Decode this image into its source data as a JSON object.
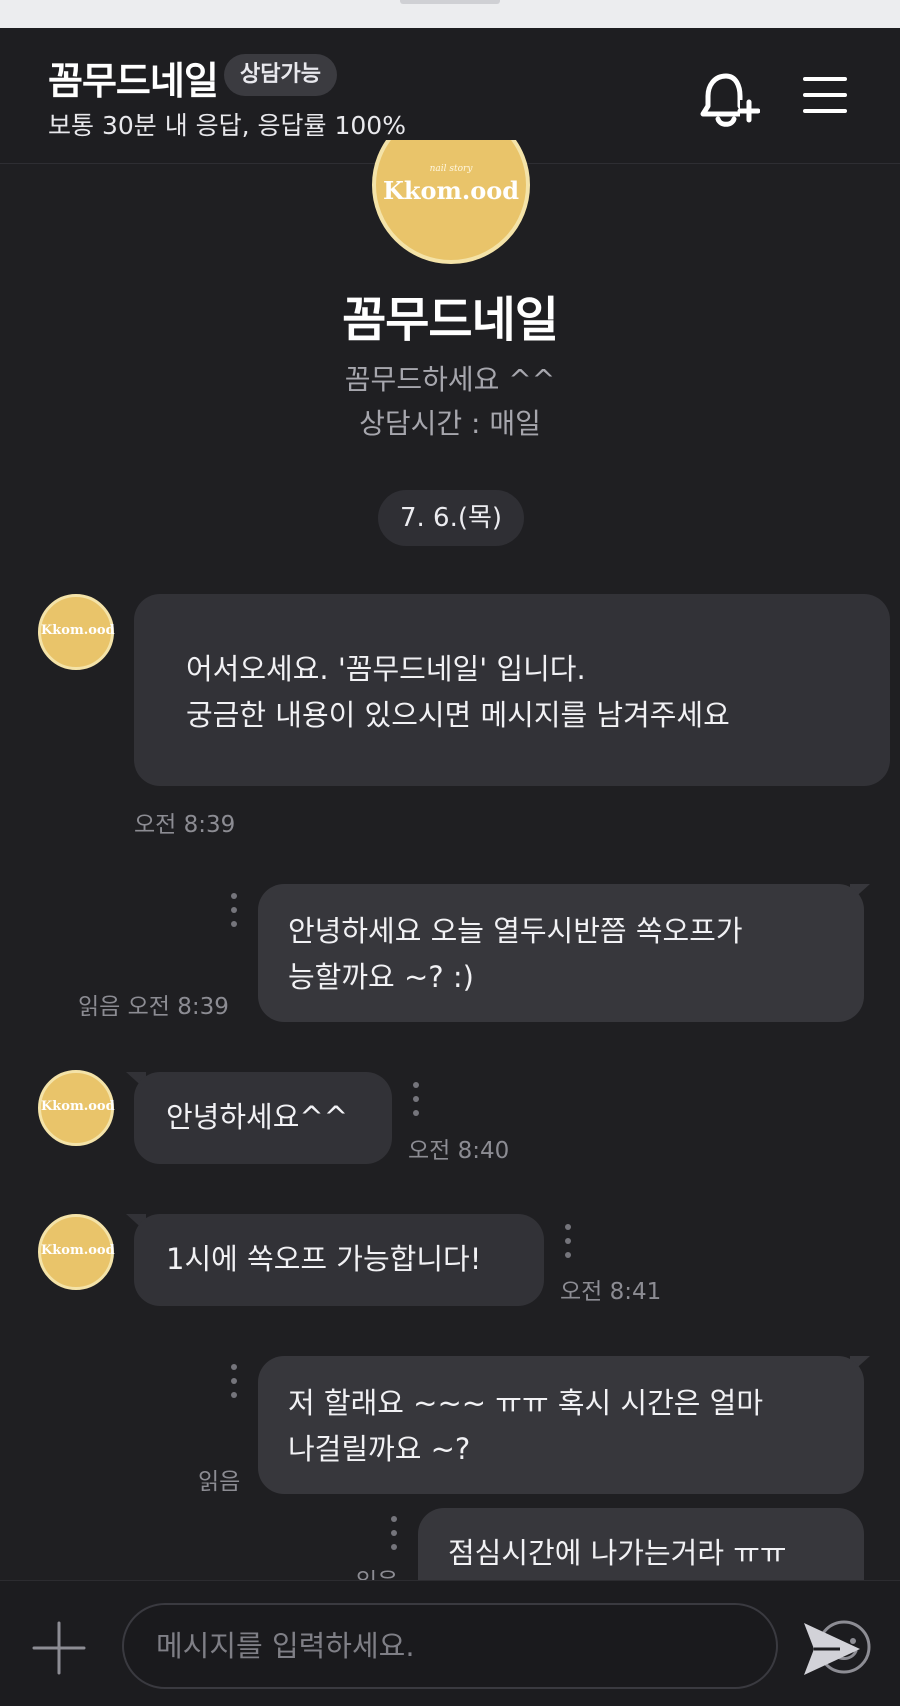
{
  "header": {
    "title": "꼼무드네일",
    "status_badge": "상담가능",
    "subtitle": "보통 30분 내 응답, 응답률 100%"
  },
  "profile": {
    "logo_text": "Kkom.ood",
    "logo_small": "nail story",
    "name": "꼼무드네일",
    "intro_line1": "꼼무드하세요 ^^",
    "intro_line2": "상담시간 : 매일"
  },
  "date_label": "7. 6.(목)",
  "messages": [
    {
      "side": "in",
      "lines": [
        "어서오세요. '꼼무드네일' 입니다.",
        "궁금한 내용이 있으시면 메시지를 남겨주세요"
      ],
      "time": "오전 8:39"
    },
    {
      "side": "out",
      "lines": [
        "안녕하세요 오늘 열두시반쯤 쏙오프가",
        "능할까요 ~? :)"
      ],
      "time": "읽음 오전 8:39"
    },
    {
      "side": "in",
      "lines": [
        "안녕하세요^^"
      ],
      "time": "오전 8:40"
    },
    {
      "side": "in",
      "lines": [
        "1시에 쏙오프 가능합니다!"
      ],
      "time": "오전 8:41"
    },
    {
      "side": "out",
      "lines": [
        "저 할래요 ~~~ ㅠㅠ 혹시 시간은 얼마",
        "나걸릴까요 ~?"
      ],
      "time": "읽음"
    },
    {
      "side": "out",
      "lines": [
        "점심시간에 나가는거라 ㅠㅠ"
      ],
      "time": "읽음"
    }
  ],
  "input": {
    "placeholder": "메시지를 입력하세요."
  },
  "colors": {
    "background": "#1f1f22",
    "bubble": "#37373c",
    "avatar": "#e9c46a"
  }
}
